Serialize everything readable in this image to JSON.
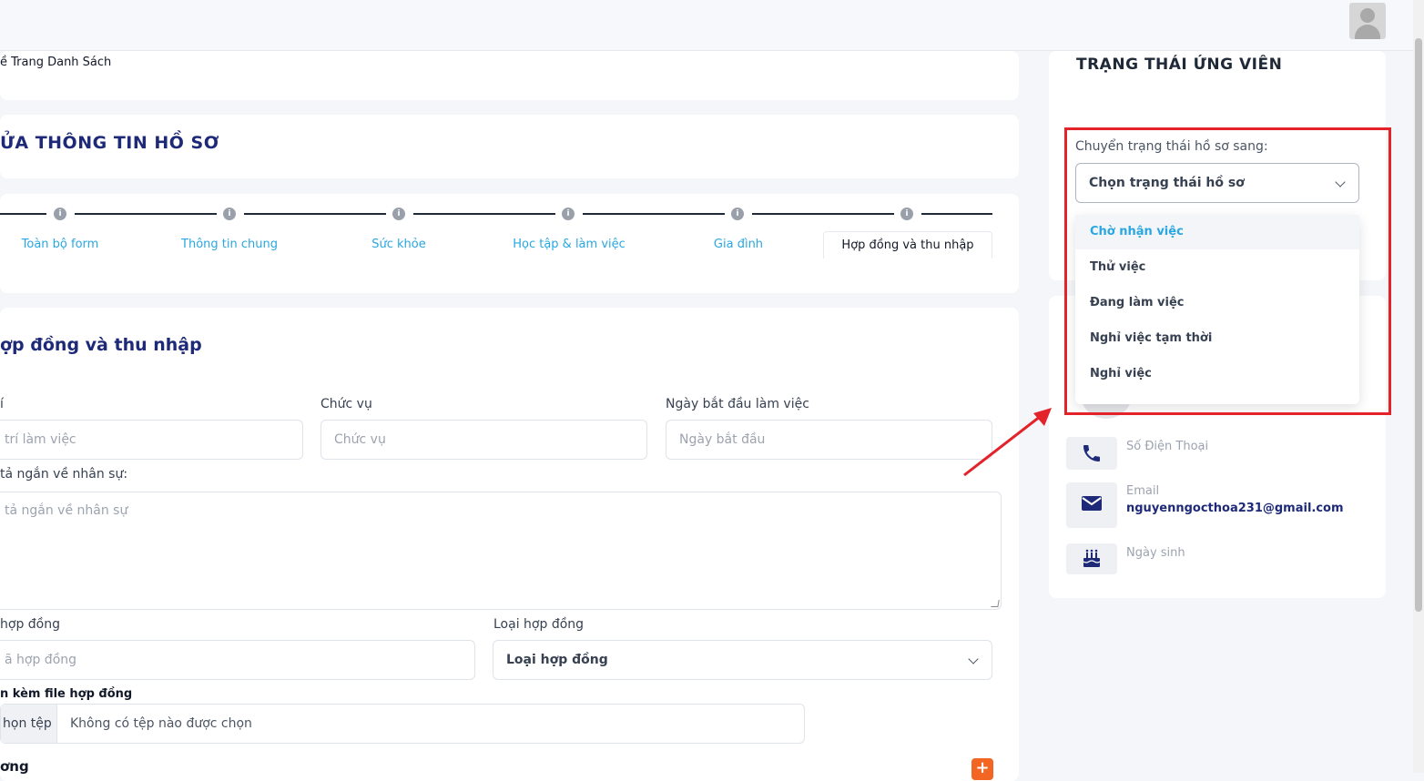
{
  "header": {
    "back_link": "ề Trang Danh Sách",
    "page_title": "ỬA THÔNG TIN HỒ SƠ"
  },
  "stepper": {
    "tabs": [
      {
        "label": "Toàn bộ form"
      },
      {
        "label": "Thông tin chung"
      },
      {
        "label": "Sức khỏe"
      },
      {
        "label": "Học tập & làm việc"
      },
      {
        "label": "Gia đình"
      },
      {
        "label": "Hợp đồng và thu nhập"
      }
    ],
    "dot_glyph": "i"
  },
  "form": {
    "section_title": "ợp đồng và thu nhập",
    "workplace": {
      "label": "í",
      "placeholder": " trí làm việc"
    },
    "position": {
      "label": "Chức vụ",
      "placeholder": "Chức vụ"
    },
    "start_date": {
      "label": "Ngày bắt đầu làm việc",
      "placeholder": "Ngày bắt đầu"
    },
    "description": {
      "label": "tả ngắn về nhân sự:",
      "placeholder": " tả ngắn về nhân sự"
    },
    "contract_code": {
      "label": "hợp đồng",
      "placeholder": "ã hợp đồng"
    },
    "contract_type": {
      "label": "Loại hợp đồng",
      "value": "Loại hợp đồng"
    },
    "attachment": {
      "label": "n kèm file hợp đồng",
      "button": "họn tệp",
      "status": "Không có tệp nào được chọn"
    },
    "salary_label": "ơng",
    "add_glyph": "+"
  },
  "status_panel": {
    "title": "TRẠNG THÁI ỨNG VIÊN",
    "select_label": "Chuyển trạng thái hồ sơ sang:",
    "select_placeholder": "Chọn trạng thái hồ sơ",
    "options": [
      {
        "label": "Chờ nhận việc",
        "highlighted": true
      },
      {
        "label": "Thử việc"
      },
      {
        "label": "Đang làm việc"
      },
      {
        "label": "Nghỉ việc tạm thời"
      },
      {
        "label": "Nghỉ việc"
      }
    ]
  },
  "contact": {
    "phone_label": "Số Điện Thoại",
    "email_label": "Email",
    "email_value": "nguyenngocthoa231@gmail.com",
    "birthday_label": "Ngày sinh"
  },
  "colors": {
    "primary_navy": "#1e2a78",
    "link_blue": "#2aa7e0",
    "highlight_red": "#e3222a",
    "add_orange": "#f26522"
  }
}
